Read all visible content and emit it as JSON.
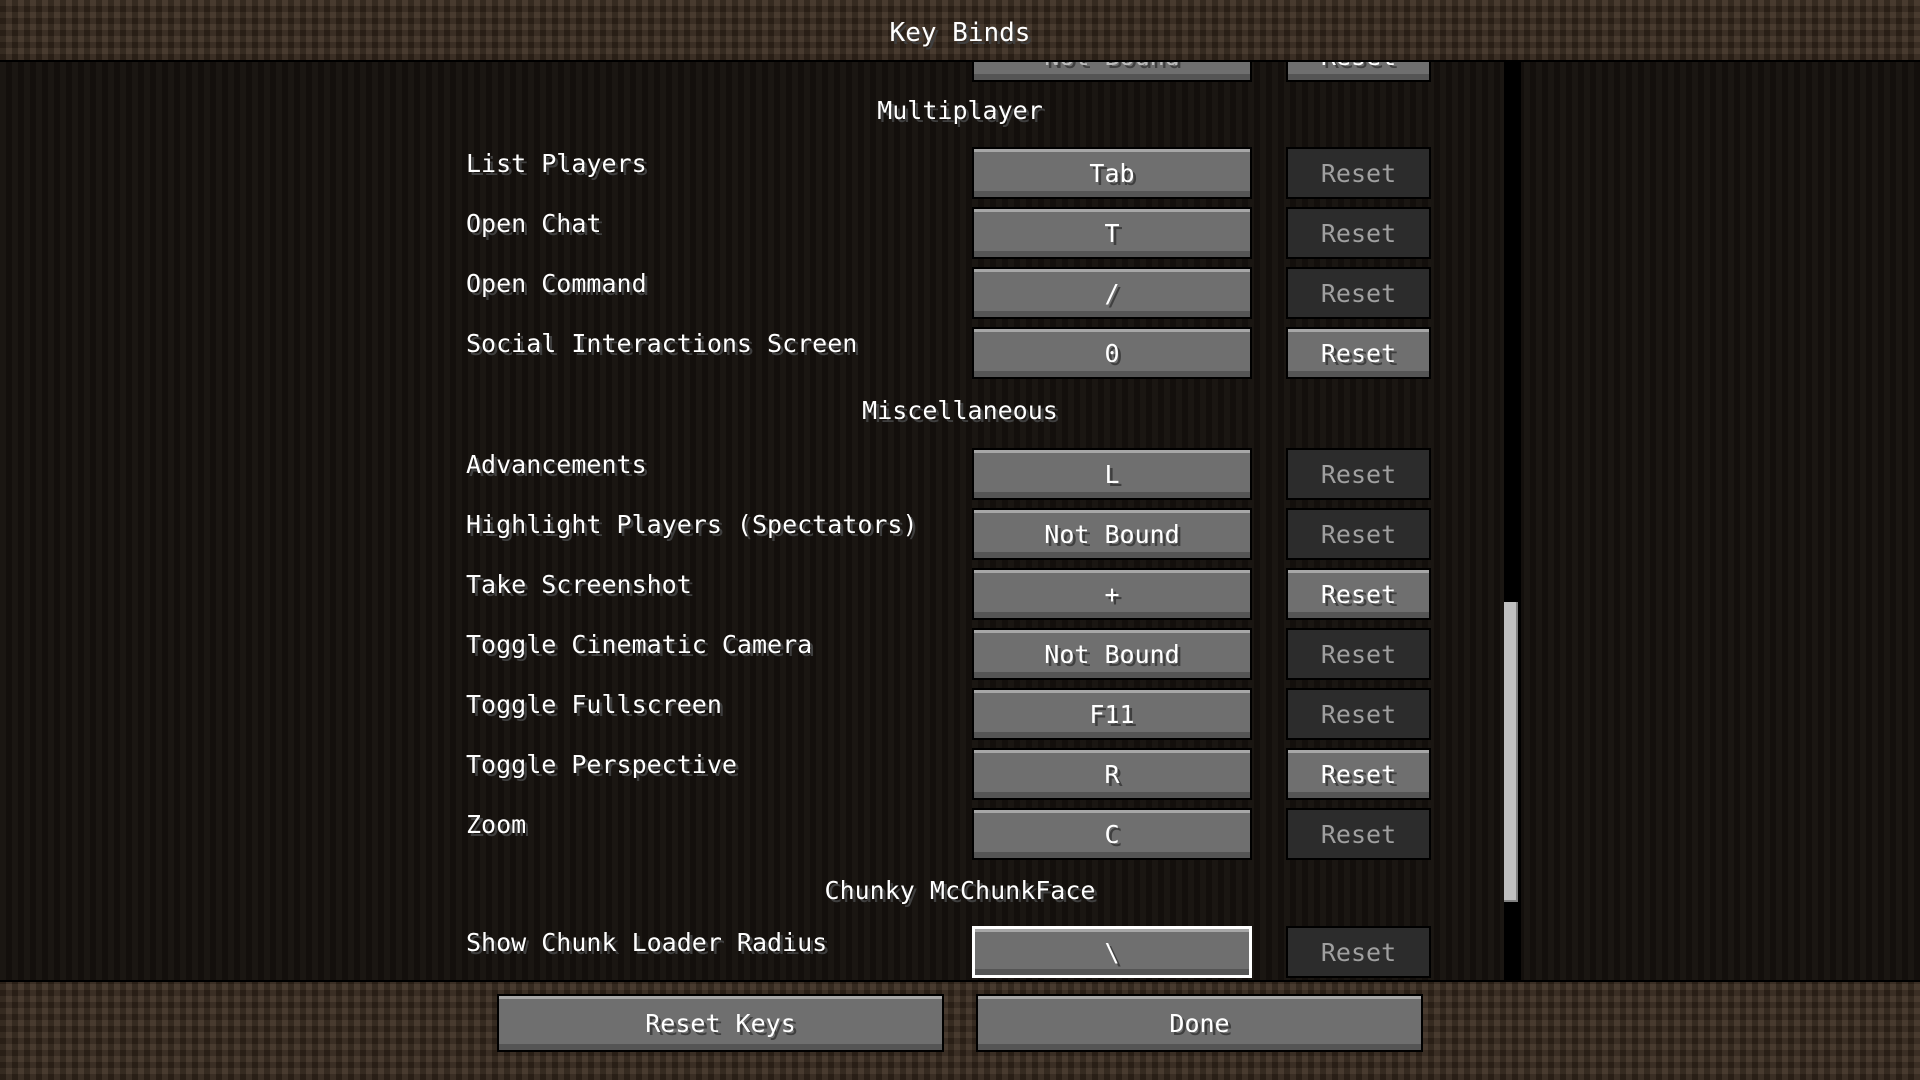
{
  "header": {
    "title": "Key Binds"
  },
  "partial_row": {
    "key": "Not Bound",
    "reset": "Reset"
  },
  "sections": [
    {
      "title": "Multiplayer",
      "rows": [
        {
          "label": "List Players",
          "key": "Tab",
          "reset": "Reset",
          "reset_enabled": false
        },
        {
          "label": "Open Chat",
          "key": "T",
          "reset": "Reset",
          "reset_enabled": false
        },
        {
          "label": "Open Command",
          "key": "/",
          "reset": "Reset",
          "reset_enabled": false
        },
        {
          "label": "Social Interactions Screen",
          "key": "0",
          "reset": "Reset",
          "reset_enabled": true
        }
      ]
    },
    {
      "title": "Miscellaneous",
      "rows": [
        {
          "label": "Advancements",
          "key": "L",
          "reset": "Reset",
          "reset_enabled": false
        },
        {
          "label": "Highlight Players (Spectators)",
          "key": "Not Bound",
          "reset": "Reset",
          "reset_enabled": false
        },
        {
          "label": "Take Screenshot",
          "key": "+",
          "reset": "Reset",
          "reset_enabled": true
        },
        {
          "label": "Toggle Cinematic Camera",
          "key": "Not Bound",
          "reset": "Reset",
          "reset_enabled": false
        },
        {
          "label": "Toggle Fullscreen",
          "key": "F11",
          "reset": "Reset",
          "reset_enabled": false
        },
        {
          "label": "Toggle Perspective",
          "key": "R",
          "reset": "Reset",
          "reset_enabled": true
        },
        {
          "label": "Zoom",
          "key": "C",
          "reset": "Reset",
          "reset_enabled": false
        }
      ]
    },
    {
      "title": "Chunky McChunkFace",
      "rows": [
        {
          "label": "Show Chunk Loader Radius",
          "key": "\\",
          "reset": "Reset",
          "reset_enabled": false,
          "selected": true
        }
      ]
    }
  ],
  "footer": {
    "reset_keys": "Reset Keys",
    "done": "Done"
  },
  "scrollbar": {
    "position_fraction": 0.8
  }
}
